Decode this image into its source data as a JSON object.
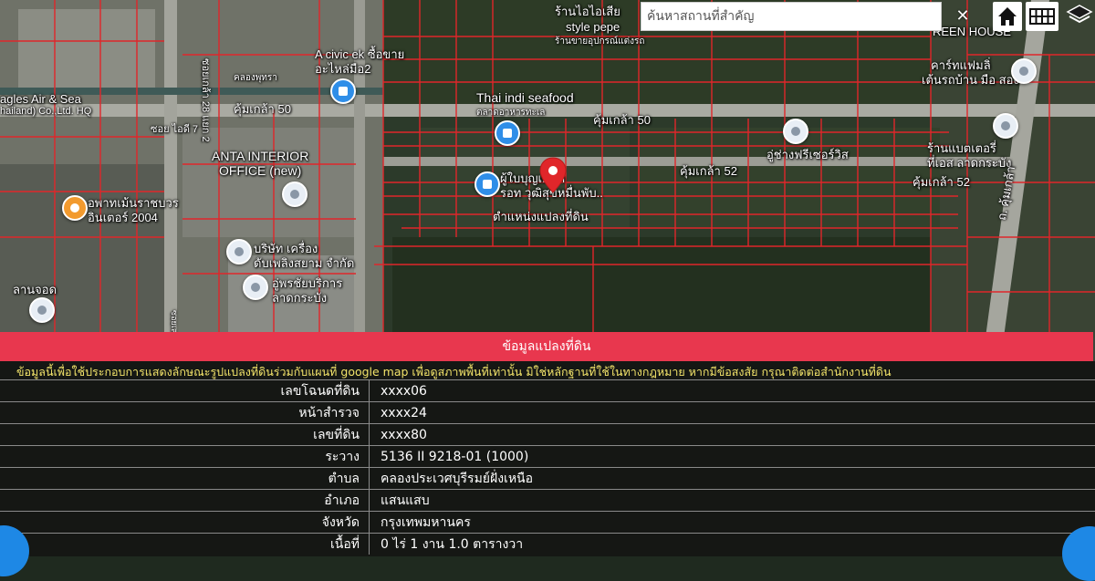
{
  "search": {
    "placeholder": "ค้นหาสถานที่สำคัญ",
    "clear_icon": "close-icon"
  },
  "toolbar": {
    "home_icon": "home-icon",
    "grid_icon": "grid-icon",
    "layers_icon": "layers-icon"
  },
  "map": {
    "labels": [
      "ร้านไอไอเสีย",
      "style pepe",
      "ร้านขายอุปกรณ์แต่งรถ",
      "A civic ek ซื้อขาย",
      "อะไหล่มือ2",
      "คลองพุทรา",
      "ซอย ไอดี 7",
      "agles Air & Sea",
      "hailand) Co.,Ltd. HQ",
      "Thai indi seafood",
      "ตลาดอาหารทะเล",
      "คุ้มเกล้า 50",
      "คุ้มเกล้า 50",
      "ANTA INTERIOR",
      "OFFICE (new)",
      "อพาทเม้นราชบวร",
      "อินเตอร์ 2004",
      "ผู้ใบบุญเดชัก",
      "รอท วุฒิสุขหมื่นพับ..",
      "ตำแหน่งแปลงที่ดิน",
      "คุ้มเกล้า 52",
      "คุ้มเกล้า 52",
      "อู่ช่างฟรีเซอร์วิส",
      "ร้านแบตเตอรี่",
      "ที่เอส ลาดกระบัง",
      "คาร์ทแฟมลิ่",
      "เต้นรถบ้าน มือ สอง",
      "REEN HOUSE",
      "บริษัท เครื่อง",
      "ดับเพลิงสยาม จำกัด",
      "อู่พรชัยบริการ",
      "ลาดกระบัง",
      "ลานจอด",
      "ถ. คุ้มเกล้า",
      "ซอยเกล้า 28 แยก 2",
      "ซอยเลข"
    ]
  },
  "panel": {
    "title": "ข้อมูลแปลงที่ดิน",
    "disclaimer": "ข้อมูลนี้เพื่อใช้ประกอบการแสดงลักษณะรูปแปลงที่ดินร่วมกับแผนที่ google map เพื่อดูสภาพพื้นที่เท่านั้น มิใช่หลักฐานที่ใช้ในทางกฎหมาย หากมีข้อสงสัย กรุณาติดต่อสำนักงานที่ดิน",
    "rows": [
      {
        "label": "เลขโฉนดที่ดิน",
        "value": "xxxx06"
      },
      {
        "label": "หน้าสำรวจ",
        "value": "xxxx24"
      },
      {
        "label": "เลขที่ดิน",
        "value": "xxxx80"
      },
      {
        "label": "ระวาง",
        "value": "5136 II 9218-01 (1000)"
      },
      {
        "label": "ตำบล",
        "value": "คลองประเวศบุรีรมย์ฝั่งเหนือ"
      },
      {
        "label": "อำเภอ",
        "value": "แสนแสบ"
      },
      {
        "label": "จังหวัด",
        "value": "กรุงเทพมหานคร"
      },
      {
        "label": "เนื้อที่",
        "value": "0 ไร่ 1 งาน 1.0 ตารางวา"
      }
    ]
  },
  "colors": {
    "panel_header": "#e8374e",
    "disclaimer": "#f2e36a",
    "parcel_lines": "#e0262a",
    "marker": "#e0262a"
  }
}
